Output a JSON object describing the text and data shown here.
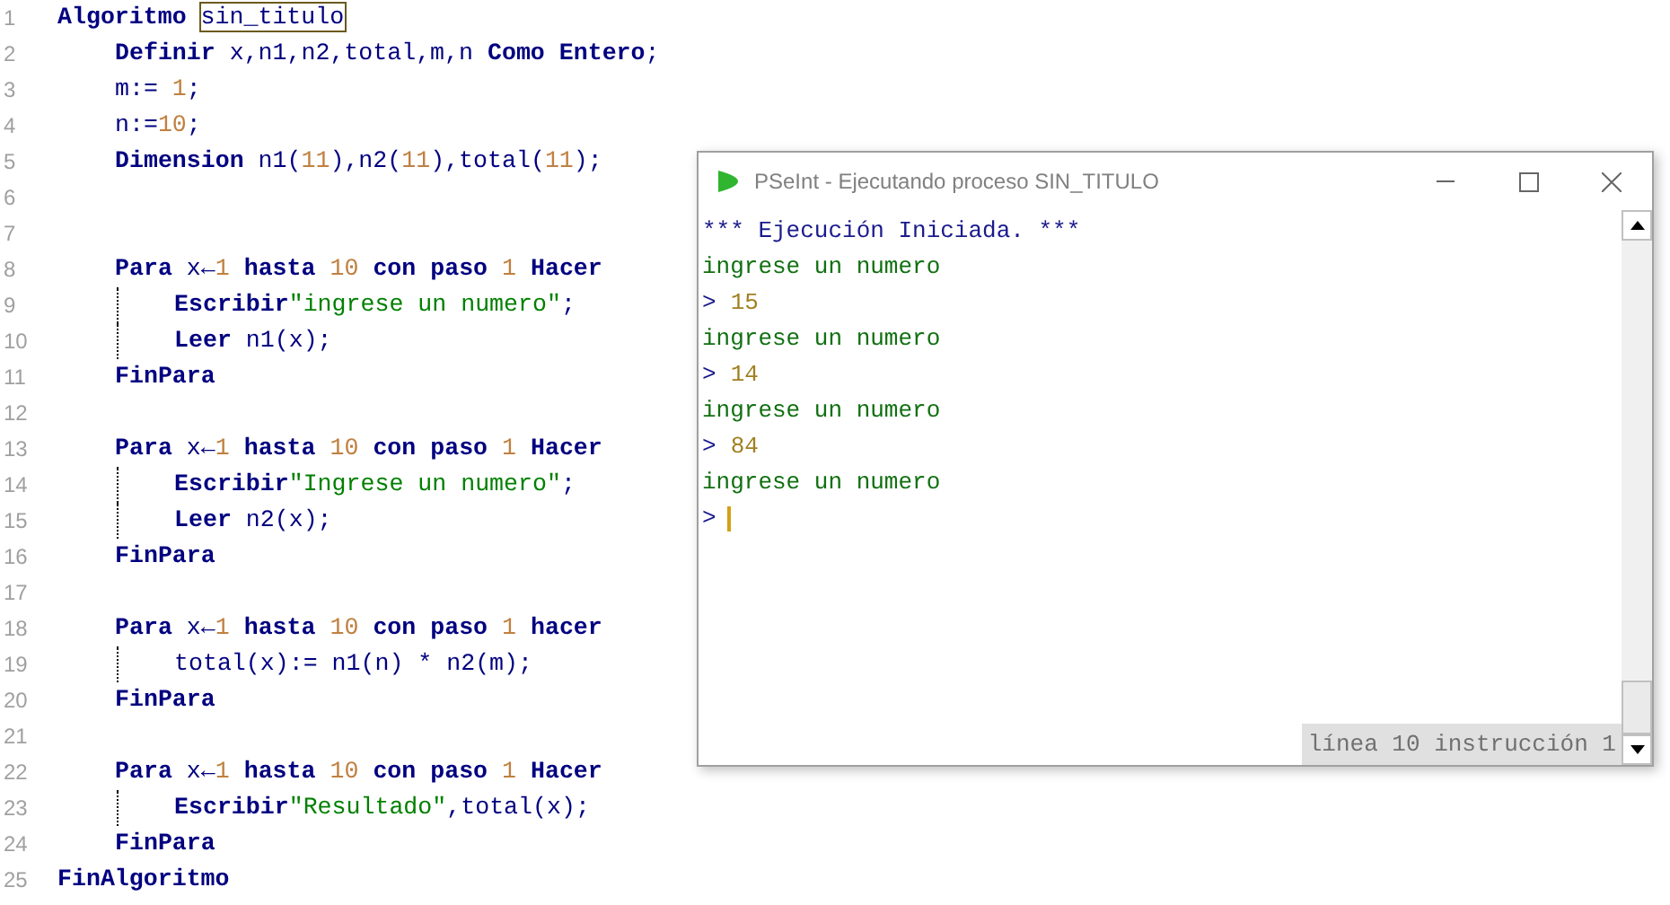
{
  "editor": {
    "lines": [
      {
        "number": "1",
        "kind": "top",
        "tokens": [
          {
            "t": "Algoritmo ",
            "kind": "kw"
          },
          {
            "t": "sin_titulo",
            "kind": "box"
          }
        ]
      },
      {
        "number": "2",
        "kind": "inner",
        "tokens": [
          {
            "t": "Definir ",
            "kind": "kw"
          },
          {
            "t": "x,n1,n2,total,m,n ",
            "kind": "plain"
          },
          {
            "t": "Como Entero",
            "kind": "kw"
          },
          {
            "t": ";",
            "kind": "plain"
          }
        ]
      },
      {
        "number": "3",
        "kind": "inner",
        "tokens": [
          {
            "t": "m:= ",
            "kind": "plain"
          },
          {
            "t": "1",
            "kind": "num"
          },
          {
            "t": ";",
            "kind": "plain"
          }
        ]
      },
      {
        "number": "4",
        "kind": "inner",
        "tokens": [
          {
            "t": "n:=",
            "kind": "plain"
          },
          {
            "t": "10",
            "kind": "num"
          },
          {
            "t": ";",
            "kind": "plain"
          }
        ]
      },
      {
        "number": "5",
        "kind": "inner",
        "tokens": [
          {
            "t": "Dimension ",
            "kind": "kw"
          },
          {
            "t": "n1(",
            "kind": "plain"
          },
          {
            "t": "11",
            "kind": "num"
          },
          {
            "t": "),n2(",
            "kind": "plain"
          },
          {
            "t": "11",
            "kind": "num"
          },
          {
            "t": "),total(",
            "kind": "plain"
          },
          {
            "t": "11",
            "kind": "num"
          },
          {
            "t": ");",
            "kind": "plain"
          }
        ]
      },
      {
        "number": "6",
        "kind": "top"
      },
      {
        "number": "7",
        "kind": "top"
      },
      {
        "number": "8",
        "kind": "inner",
        "tokens": [
          {
            "t": "Para ",
            "kind": "kw"
          },
          {
            "t": "x←",
            "kind": "plain"
          },
          {
            "t": "1 ",
            "kind": "num"
          },
          {
            "t": "hasta ",
            "kind": "kw"
          },
          {
            "t": "10 ",
            "kind": "num"
          },
          {
            "t": "con paso ",
            "kind": "kw"
          },
          {
            "t": "1 ",
            "kind": "num"
          },
          {
            "t": "Hacer",
            "kind": "kw"
          }
        ]
      },
      {
        "number": "9",
        "kind": "block",
        "tokens": [
          {
            "t": "Escribir",
            "kind": "kw"
          },
          {
            "t": "\"ingrese un numero\"",
            "kind": "str"
          },
          {
            "t": ";",
            "kind": "plain"
          }
        ]
      },
      {
        "number": "10",
        "kind": "block",
        "tokens": [
          {
            "t": "Leer ",
            "kind": "kw"
          },
          {
            "t": "n1(x);",
            "kind": "plain"
          }
        ]
      },
      {
        "number": "11",
        "kind": "inner",
        "tokens": [
          {
            "t": "FinPara",
            "kind": "kw"
          }
        ]
      },
      {
        "number": "12",
        "kind": "top"
      },
      {
        "number": "13",
        "kind": "inner",
        "tokens": [
          {
            "t": "Para ",
            "kind": "kw"
          },
          {
            "t": "x←",
            "kind": "plain"
          },
          {
            "t": "1 ",
            "kind": "num"
          },
          {
            "t": "hasta ",
            "kind": "kw"
          },
          {
            "t": "10 ",
            "kind": "num"
          },
          {
            "t": "con paso ",
            "kind": "kw"
          },
          {
            "t": "1 ",
            "kind": "num"
          },
          {
            "t": "Hacer",
            "kind": "kw"
          }
        ]
      },
      {
        "number": "14",
        "kind": "block",
        "tokens": [
          {
            "t": "Escribir",
            "kind": "kw"
          },
          {
            "t": "\"Ingrese un numero\"",
            "kind": "str"
          },
          {
            "t": ";",
            "kind": "plain"
          }
        ]
      },
      {
        "number": "15",
        "kind": "block",
        "tokens": [
          {
            "t": "Leer ",
            "kind": "kw"
          },
          {
            "t": "n2(x);",
            "kind": "plain"
          }
        ]
      },
      {
        "number": "16",
        "kind": "inner",
        "tokens": [
          {
            "t": "FinPara",
            "kind": "kw"
          }
        ]
      },
      {
        "number": "17",
        "kind": "top"
      },
      {
        "number": "18",
        "kind": "inner",
        "tokens": [
          {
            "t": "Para ",
            "kind": "kw"
          },
          {
            "t": "x←",
            "kind": "plain"
          },
          {
            "t": "1 ",
            "kind": "num"
          },
          {
            "t": "hasta ",
            "kind": "kw"
          },
          {
            "t": "10 ",
            "kind": "num"
          },
          {
            "t": "con paso ",
            "kind": "kw"
          },
          {
            "t": "1 ",
            "kind": "num"
          },
          {
            "t": "hacer",
            "kind": "kw"
          }
        ]
      },
      {
        "number": "19",
        "kind": "block",
        "tokens": [
          {
            "t": "total(x):= n1(n) * n2(m);",
            "kind": "plain"
          }
        ]
      },
      {
        "number": "20",
        "kind": "inner",
        "tokens": [
          {
            "t": "FinPara",
            "kind": "kw"
          }
        ]
      },
      {
        "number": "21",
        "kind": "top"
      },
      {
        "number": "22",
        "kind": "inner",
        "tokens": [
          {
            "t": "Para ",
            "kind": "kw"
          },
          {
            "t": "x←",
            "kind": "plain"
          },
          {
            "t": "1 ",
            "kind": "num"
          },
          {
            "t": "hasta ",
            "kind": "kw"
          },
          {
            "t": "10 ",
            "kind": "num"
          },
          {
            "t": "con paso ",
            "kind": "kw"
          },
          {
            "t": "1 ",
            "kind": "num"
          },
          {
            "t": "Hacer",
            "kind": "kw"
          }
        ]
      },
      {
        "number": "23",
        "kind": "block",
        "tokens": [
          {
            "t": "Escribir",
            "kind": "kw"
          },
          {
            "t": "\"Resultado\"",
            "kind": "str"
          },
          {
            "t": ",total(x);",
            "kind": "plain"
          }
        ]
      },
      {
        "number": "24",
        "kind": "inner",
        "tokens": [
          {
            "t": "FinPara",
            "kind": "kw"
          }
        ]
      },
      {
        "number": "25",
        "kind": "top",
        "tokens": [
          {
            "t": "FinAlgoritmo",
            "kind": "kw"
          }
        ]
      }
    ]
  },
  "console": {
    "title": "PSeInt - Ejecutando proceso SIN_TITULO",
    "lines": [
      {
        "kind": "info",
        "text": "*** Ejecución Iniciada. ***"
      },
      {
        "kind": "output",
        "text": "ingrese un numero"
      },
      {
        "kind": "input",
        "prompt": ">",
        "text": "15"
      },
      {
        "kind": "output",
        "text": "ingrese un numero"
      },
      {
        "kind": "input",
        "prompt": ">",
        "text": "14"
      },
      {
        "kind": "output",
        "text": "ingrese un numero"
      },
      {
        "kind": "input",
        "prompt": ">",
        "text": "84"
      },
      {
        "kind": "output",
        "text": "ingrese un numero"
      },
      {
        "kind": "input",
        "prompt": ">",
        "cursor": true
      }
    ],
    "status": "línea 10 instrucción 1"
  }
}
